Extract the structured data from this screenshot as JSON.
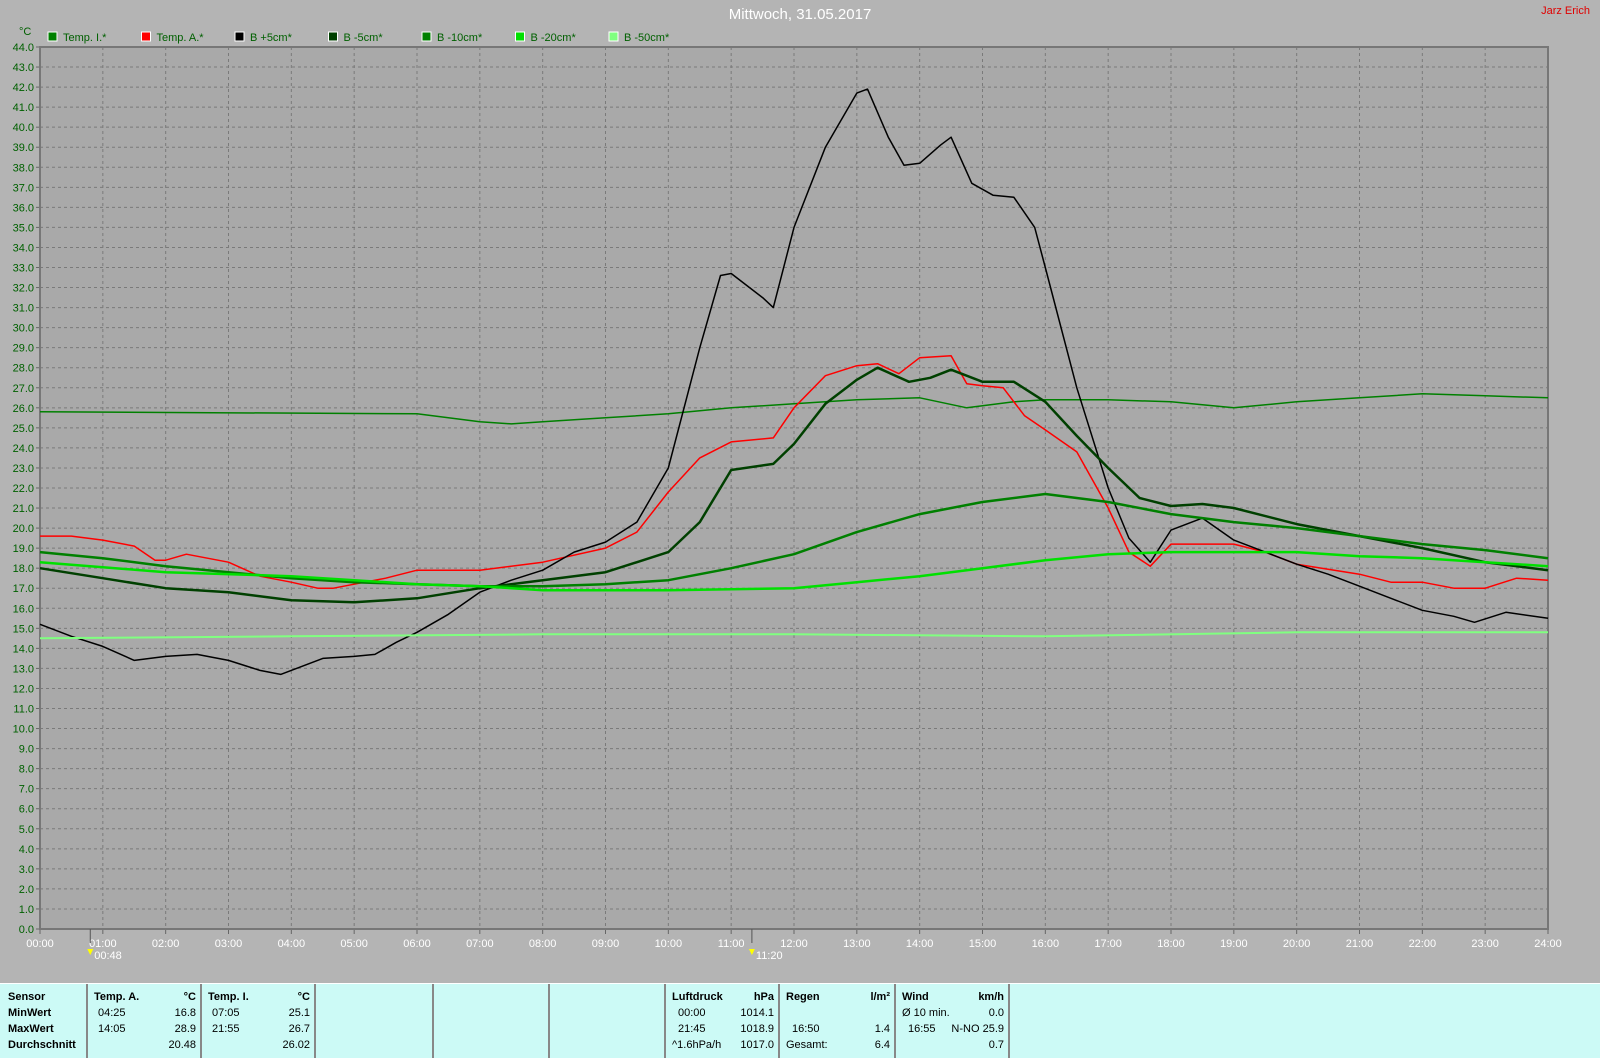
{
  "header": {
    "title": "Mittwoch, 31.05.2017",
    "author": "Jarz Erich"
  },
  "chart_data": {
    "type": "line",
    "title": "Mittwoch, 31.05.2017",
    "ylabel": "°C",
    "xlabel": "",
    "ylim": [
      0,
      44
    ],
    "xlim": [
      0,
      24
    ],
    "grid": true,
    "legend": "top-left",
    "yticks": [
      "0.0",
      "1.0",
      "2.0",
      "3.0",
      "4.0",
      "5.0",
      "6.0",
      "7.0",
      "8.0",
      "9.0",
      "10.0",
      "11.0",
      "12.0",
      "13.0",
      "14.0",
      "15.0",
      "16.0",
      "17.0",
      "18.0",
      "19.0",
      "20.0",
      "21.0",
      "22.0",
      "23.0",
      "24.0",
      "25.0",
      "26.0",
      "27.0",
      "28.0",
      "29.0",
      "30.0",
      "31.0",
      "32.0",
      "33.0",
      "34.0",
      "35.0",
      "36.0",
      "37.0",
      "38.0",
      "39.0",
      "40.0",
      "41.0",
      "42.0",
      "43.0",
      "44.0"
    ],
    "xticks": [
      "00:00",
      "01:00",
      "02:00",
      "03:00",
      "04:00",
      "05:00",
      "06:00",
      "07:00",
      "08:00",
      "09:00",
      "10:00",
      "11:00",
      "12:00",
      "13:00",
      "14:00",
      "15:00",
      "16:00",
      "17:00",
      "18:00",
      "19:00",
      "20:00",
      "21:00",
      "22:00",
      "23:00",
      "24:00"
    ],
    "markers": [
      {
        "label": "00:48",
        "x": 0.8,
        "icon": "moonrise-icon"
      },
      {
        "label": "11:20",
        "x": 11.33,
        "icon": "moonset-icon"
      }
    ],
    "series": [
      {
        "name": "Temp. I.*",
        "color": "#008000",
        "width": 1.5,
        "x": [
          0,
          6,
          7,
          7.5,
          8,
          9,
          10,
          11,
          12,
          13,
          14,
          14.75,
          15.5,
          16,
          17,
          18,
          19,
          20,
          21,
          22,
          23,
          24
        ],
        "y": [
          25.8,
          25.7,
          25.3,
          25.2,
          25.3,
          25.5,
          25.7,
          26.0,
          26.2,
          26.4,
          26.5,
          26.0,
          26.3,
          26.4,
          26.4,
          26.3,
          26.0,
          26.3,
          26.5,
          26.7,
          26.6,
          26.5
        ]
      },
      {
        "name": "Temp. A.*",
        "color": "#ff0000",
        "width": 1.5,
        "x": [
          0,
          0.5,
          1,
          1.5,
          1.83,
          2,
          2.33,
          3,
          3.5,
          4,
          4.42,
          4.67,
          5,
          5.5,
          6,
          7,
          8,
          9,
          9.5,
          10,
          10.5,
          11,
          11.67,
          12,
          12.5,
          13,
          13.33,
          13.67,
          14,
          14.5,
          14.75,
          15,
          15.33,
          15.67,
          16,
          16.5,
          17,
          17.33,
          17.67,
          18,
          19,
          19.5,
          20,
          21,
          21.5,
          22,
          22.5,
          23,
          23.5,
          24
        ],
        "y": [
          19.6,
          19.6,
          19.4,
          19.1,
          18.4,
          18.4,
          18.7,
          18.3,
          17.6,
          17.3,
          17.0,
          17.0,
          17.2,
          17.5,
          17.9,
          17.9,
          18.3,
          19.0,
          19.8,
          21.8,
          23.5,
          24.3,
          24.5,
          26.0,
          27.6,
          28.1,
          28.2,
          27.7,
          28.5,
          28.6,
          27.2,
          27.1,
          27.0,
          25.6,
          24.9,
          23.8,
          21.0,
          18.8,
          18.1,
          19.2,
          19.2,
          18.8,
          18.2,
          17.7,
          17.3,
          17.3,
          17.0,
          17.0,
          17.5,
          17.4
        ]
      },
      {
        "name": "B +5cm*",
        "color": "#000000",
        "width": 1.5,
        "x": [
          0,
          0.5,
          1,
          1.5,
          2,
          2.5,
          3,
          3.5,
          3.83,
          4.25,
          4.5,
          5,
          5.33,
          5.67,
          6,
          6.5,
          7,
          7.5,
          8,
          8.5,
          9,
          9.5,
          10,
          10.5,
          10.83,
          11,
          11.5,
          11.67,
          12,
          12.5,
          13,
          13.17,
          13.5,
          13.75,
          14,
          14.33,
          14.5,
          14.83,
          15.17,
          15.5,
          15.83,
          16,
          16.5,
          17,
          17.33,
          17.67,
          18,
          18.5,
          19,
          19.5,
          20,
          20.5,
          21,
          21.5,
          22,
          22.5,
          22.83,
          23.33,
          24
        ],
        "y": [
          15.2,
          14.6,
          14.1,
          13.4,
          13.6,
          13.7,
          13.4,
          12.9,
          12.7,
          13.2,
          13.5,
          13.6,
          13.7,
          14.3,
          14.8,
          15.7,
          16.8,
          17.4,
          17.9,
          18.8,
          19.3,
          20.3,
          23.0,
          29.0,
          32.6,
          32.7,
          31.5,
          31.0,
          35.0,
          39.0,
          41.7,
          41.9,
          39.5,
          38.1,
          38.2,
          39.1,
          39.5,
          37.2,
          36.6,
          36.5,
          35.0,
          33.0,
          27.0,
          22.0,
          19.5,
          18.3,
          19.9,
          20.5,
          19.4,
          18.8,
          18.2,
          17.7,
          17.1,
          16.5,
          15.9,
          15.6,
          15.3,
          15.8,
          15.5
        ]
      },
      {
        "name": "B -5cm*",
        "color": "#004000",
        "width": 2.5,
        "x": [
          0,
          1,
          2,
          3,
          4,
          5,
          6,
          7,
          8,
          9,
          10,
          10.5,
          11,
          11.67,
          12,
          12.5,
          13,
          13.33,
          13.83,
          14.17,
          14.5,
          15,
          15.5,
          16,
          16.5,
          17,
          17.5,
          18,
          18.5,
          19,
          20,
          21,
          22,
          23,
          24
        ],
        "y": [
          18.0,
          17.5,
          17.0,
          16.8,
          16.4,
          16.3,
          16.5,
          17.0,
          17.4,
          17.8,
          18.8,
          20.3,
          22.9,
          23.2,
          24.2,
          26.2,
          27.4,
          28.0,
          27.3,
          27.5,
          27.9,
          27.3,
          27.3,
          26.3,
          24.6,
          23.0,
          21.5,
          21.1,
          21.2,
          21.0,
          20.2,
          19.6,
          19.0,
          18.3,
          17.9
        ]
      },
      {
        "name": "B -10cm*",
        "color": "#008000",
        "width": 2.5,
        "x": [
          0,
          1,
          2,
          3,
          4,
          5,
          6,
          7,
          8,
          9,
          10,
          11,
          12,
          13,
          14,
          15,
          16,
          17,
          18,
          19,
          20,
          21,
          22,
          23,
          24
        ],
        "y": [
          18.8,
          18.5,
          18.1,
          17.8,
          17.5,
          17.3,
          17.2,
          17.1,
          17.1,
          17.2,
          17.4,
          18.0,
          18.7,
          19.8,
          20.7,
          21.3,
          21.7,
          21.3,
          20.7,
          20.3,
          20.0,
          19.6,
          19.2,
          18.9,
          18.5
        ]
      },
      {
        "name": "B -20cm*",
        "color": "#00e000",
        "width": 2.5,
        "x": [
          0,
          2,
          4,
          6,
          7,
          8,
          10,
          12,
          13,
          14,
          15,
          16,
          17,
          18,
          19,
          20,
          21,
          22,
          23,
          24
        ],
        "y": [
          18.3,
          17.8,
          17.6,
          17.2,
          17.1,
          16.9,
          16.9,
          17.0,
          17.3,
          17.6,
          18.0,
          18.4,
          18.7,
          18.8,
          18.8,
          18.8,
          18.6,
          18.5,
          18.3,
          18.1
        ]
      },
      {
        "name": "B -50cm*",
        "color": "#80ff80",
        "width": 2,
        "x": [
          0,
          4,
          8,
          12,
          16,
          20,
          24
        ],
        "y": [
          14.5,
          14.6,
          14.7,
          14.7,
          14.6,
          14.8,
          14.8
        ]
      }
    ]
  },
  "table": {
    "sensor": {
      "title": "Sensor",
      "rows": [
        "MinWert",
        "MaxWert",
        "Durchschnitt"
      ]
    },
    "temp_a": {
      "title": "Temp. A.",
      "unit": "°C",
      "min_time": "04:25",
      "min": "16.8",
      "max_time": "14:05",
      "max": "28.9",
      "avg": "20.48"
    },
    "temp_i": {
      "title": "Temp. I.",
      "unit": "°C",
      "min_time": "07:05",
      "min": "25.1",
      "max_time": "21:55",
      "max": "26.7",
      "avg": "26.02"
    },
    "pressure": {
      "title": "Luftdruck",
      "unit": "hPa",
      "r1a": "00:00",
      "r1b": "1014.1",
      "r2a": "21:45",
      "r2b": "1018.9",
      "r3a": "^1.6hPa/h",
      "r3b": "1017.0"
    },
    "rain": {
      "title": "Regen",
      "unit": "l/m²",
      "r2a": "16:50",
      "r2b": "1.4",
      "r3a": "Gesamt:",
      "r3b": "6.4"
    },
    "wind": {
      "title": "Wind",
      "unit": "km/h",
      "r1a": "Ø 10 min.",
      "r1b": "0.0",
      "r2a": "16:55",
      "r2b": "N-NO 25.9",
      "r3b": "0.7"
    }
  }
}
